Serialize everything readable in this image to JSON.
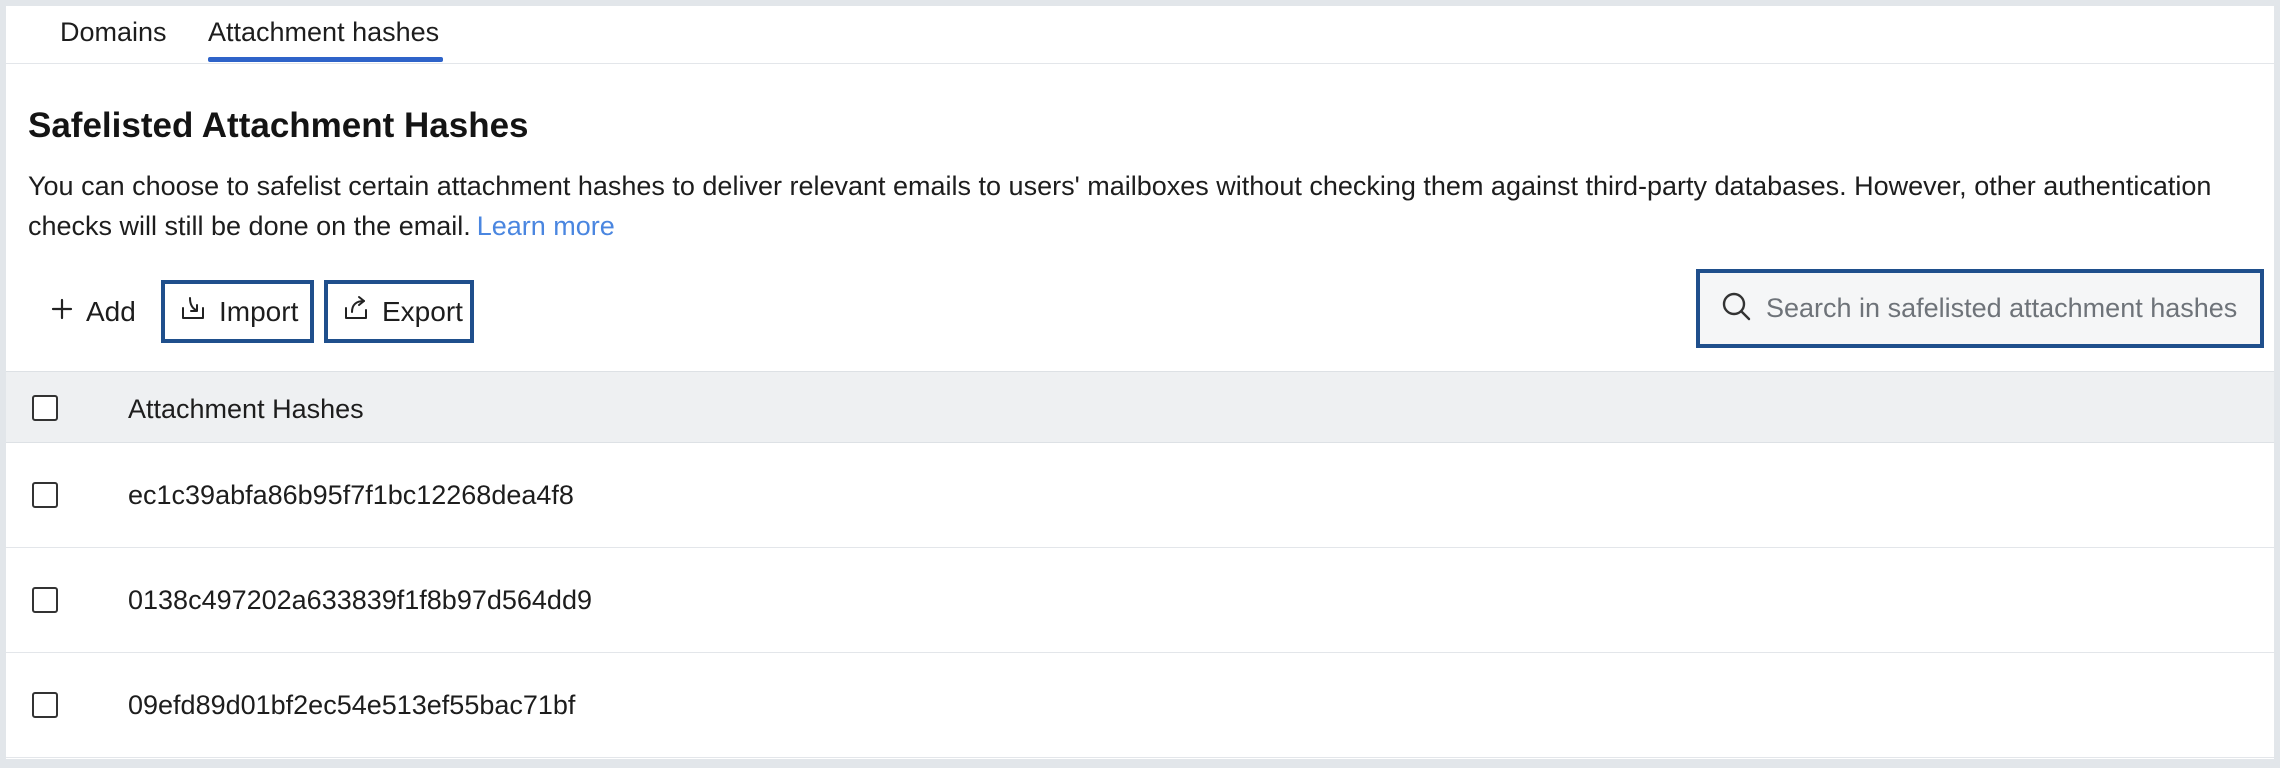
{
  "tabs": [
    {
      "label": "Domains",
      "active": false
    },
    {
      "label": "Attachment hashes",
      "active": true
    }
  ],
  "page": {
    "title": "Safelisted Attachment Hashes",
    "description": "You can choose to safelist certain attachment hashes to deliver relevant emails to users' mailboxes without checking them against third-party databases. However, other authentication checks will still be done on the email.",
    "learn_more": "Learn more"
  },
  "toolbar": {
    "add_label": "Add",
    "import_label": "Import",
    "export_label": "Export"
  },
  "search": {
    "placeholder": "Search in safelisted attachment hashes",
    "value": ""
  },
  "table": {
    "header": "Attachment Hashes",
    "rows": [
      "ec1c39abfa86b95f7f1bc12268dea4f8",
      "0138c497202a633839f1f8b97d564dd9",
      "09efd89d01bf2ec54e513ef55bac71bf"
    ]
  },
  "colors": {
    "accent": "#2e63c9",
    "link": "#4a86e0",
    "focus_border": "#1f4f8c",
    "header_bg": "#eef0f2"
  },
  "icons": [
    "plus-icon",
    "import-icon",
    "export-icon",
    "search-icon"
  ]
}
